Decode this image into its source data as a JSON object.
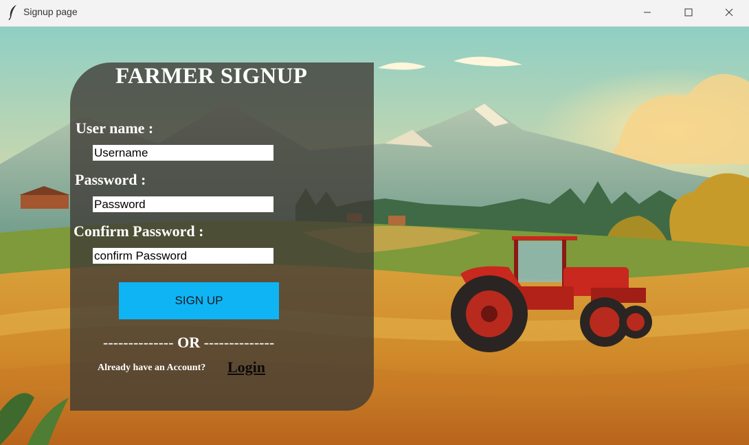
{
  "window": {
    "title": "Signup page",
    "icon": "feather-icon",
    "controls": [
      "minimize-icon",
      "maximize-icon",
      "close-icon"
    ]
  },
  "form": {
    "heading": "FARMER SIGNUP",
    "username_label": "User name :",
    "username_value": "Username",
    "password_label": "Password :",
    "password_value": "Password",
    "confirm_label": "Confirm Password :",
    "confirm_value": "confirm Password",
    "signup_button": "SIGN UP",
    "or_dashes_left": "--------------",
    "or_text": "OR",
    "or_dashes_right": "--------------",
    "already_text": "Already have an Account?",
    "login_link": "Login"
  },
  "colors": {
    "panel": "#3e3a34",
    "signup_button": "#0fb4f5",
    "tractor": "#c8281e"
  }
}
